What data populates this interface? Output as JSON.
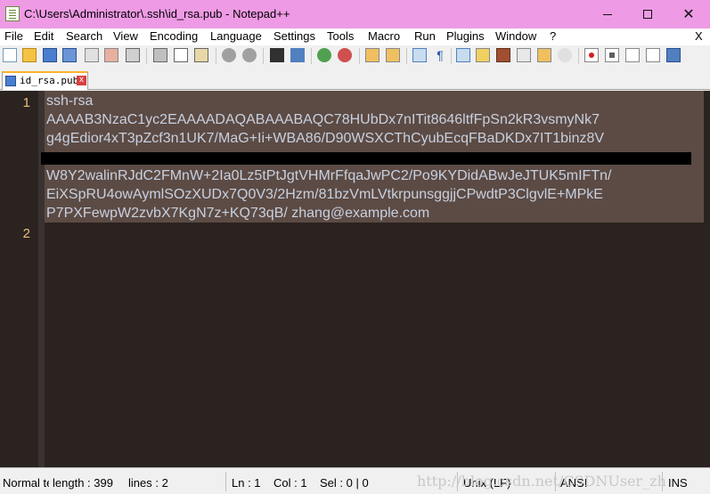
{
  "window": {
    "title": "C:\\Users\\Administrator\\.ssh\\id_rsa.pub - Notepad++",
    "app_icon": "notepad-icon"
  },
  "menu": [
    "File",
    "Edit",
    "Search",
    "View",
    "Encoding",
    "Language",
    "Settings",
    "Tools",
    "Macro",
    "Run",
    "Plugins",
    "Window",
    "?"
  ],
  "menu_close": "X",
  "tab": {
    "label": "id_rsa.pub",
    "close": "x"
  },
  "editor": {
    "line_numbers": [
      "1",
      "2"
    ],
    "lines": [
      "ssh-rsa",
      "AAAAB3NzaC1yc2EAAAADAQABAAABAQC78HUbDx7nITit8646ltfFpSn2kR3vsmyNk7",
      "g4gEdior4xT3pZcf3n1UK7/MaG+Ii+WBA86/D90WSXCThCyubEcqFBaDKDx7IT1binz8V",
      "W8Y2walinRJdC2FMnW+2Ia0Lz5tPtJgtVHMrFfqaJwPC2/Po9KYDidABwJeJTUK5mIFTn/",
      "EiXSpRU4owAymlSOzXUDx7Q0V3/2Hzm/81bzVmLVtkrpunsggjjCPwdtP3ClgvlE+MPkE",
      "P7PXFewpW2zvbX7KgN7z+KQ73qB/ zhang@example.com"
    ]
  },
  "status": {
    "doc_type": "Normal te",
    "length": "length : 399",
    "lines": "lines : 2",
    "ln": "Ln : 1",
    "col": "Col : 1",
    "sel": "Sel : 0 | 0",
    "eol": "Unix (LF)",
    "encoding": "ANSI",
    "mode": "INS",
    "watermark": "http://blog.csdn.net/CSDNUser_zh"
  },
  "colors": {
    "titlebar": "#ee9ae4",
    "editor_bg": "#2b2320",
    "selection": "#5c4b44",
    "text": "#c8d0e0",
    "line_number": "#e8c07a"
  }
}
